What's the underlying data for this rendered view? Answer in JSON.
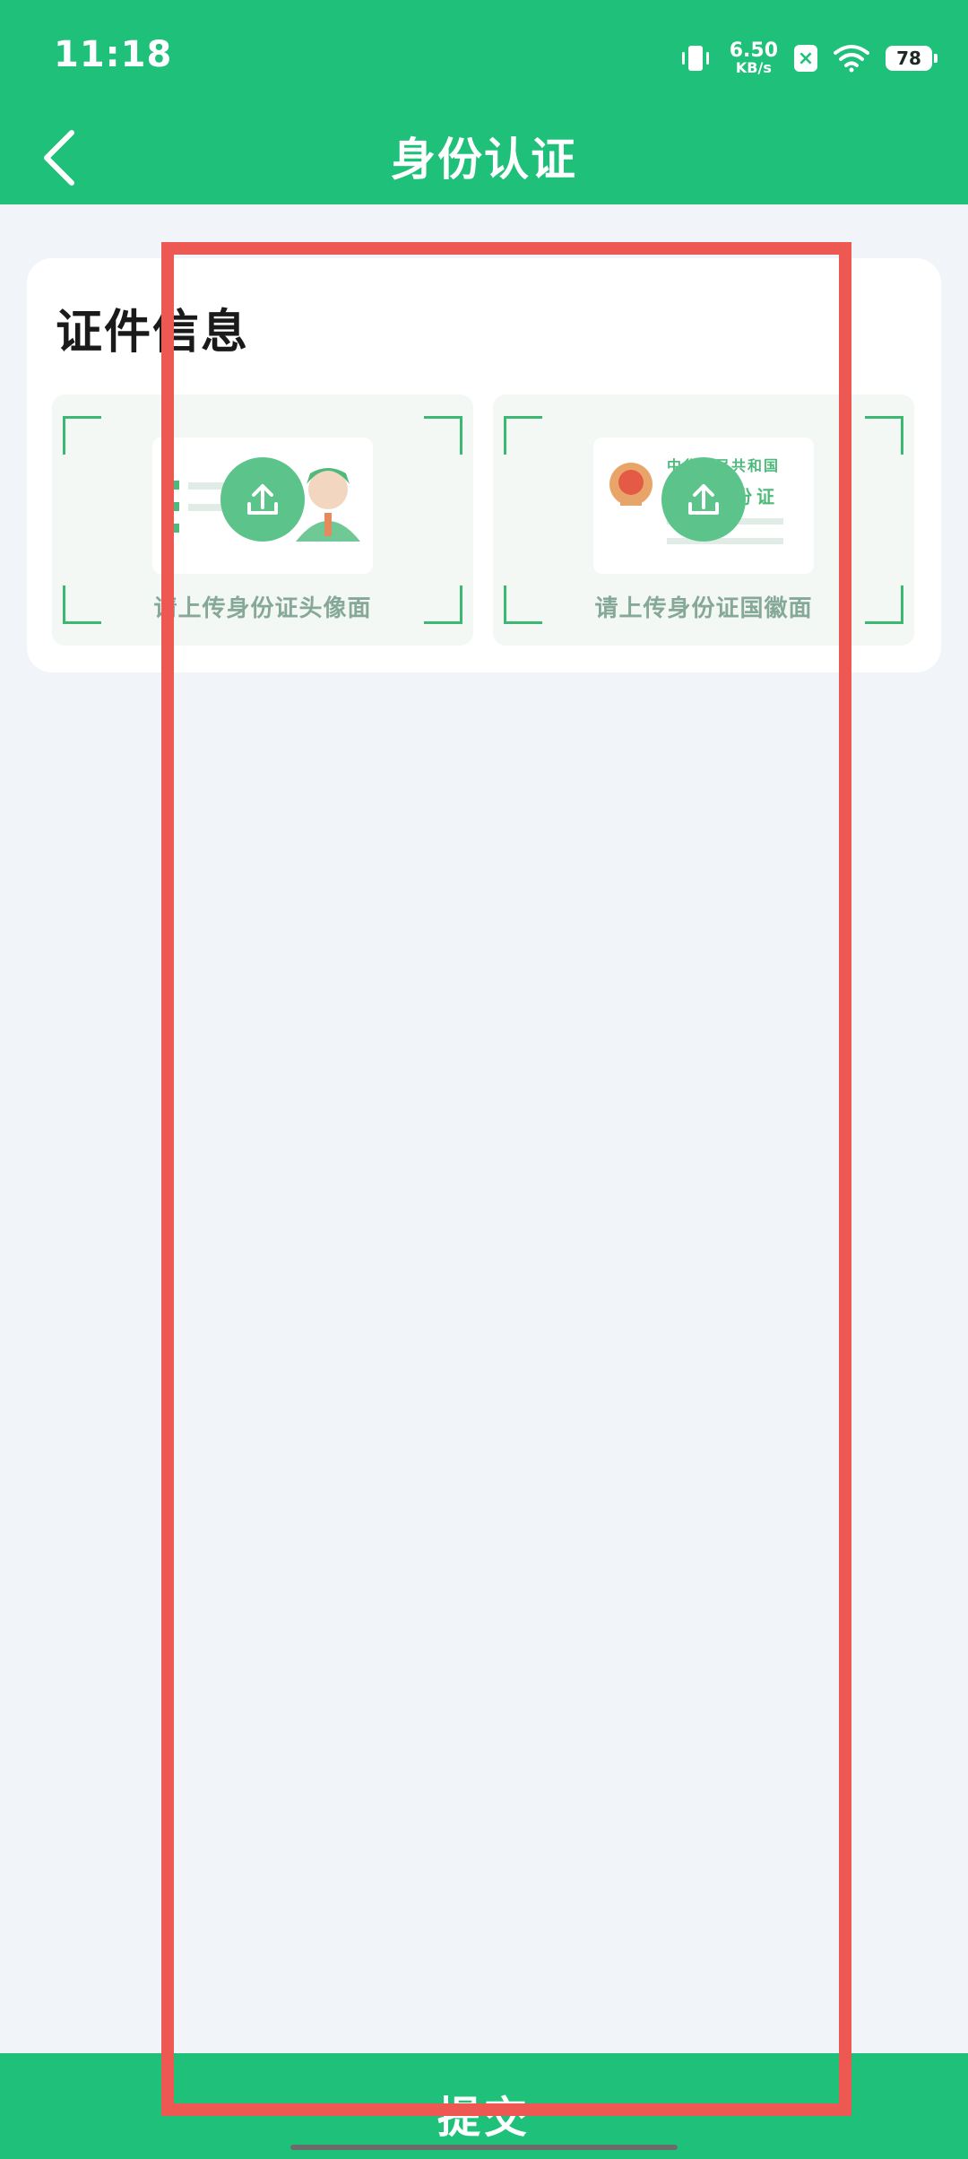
{
  "status_bar": {
    "time": "11:18",
    "net_speed_value": "6.50",
    "net_speed_unit": "KB/s",
    "notif_glyph": "×",
    "battery": "78",
    "icons": [
      "vibrate-icon",
      "wifi-icon"
    ]
  },
  "nav": {
    "title": "身份认证",
    "back_icon": "chevron-left-icon"
  },
  "section": {
    "title": "证件信息"
  },
  "uploads": {
    "front_label": "请上传身份证头像面",
    "back_label": "请上传身份证国徽面",
    "emblem_text_top": "中华人民共和国",
    "emblem_text_bottom": "居民身份证"
  },
  "footer": {
    "submit_label": "提交"
  },
  "colors": {
    "primary_green": "#1fc07a",
    "upload_green": "#5cc48a",
    "annotation_red": "#ee5853",
    "page_bg": "#f1f5f9"
  }
}
